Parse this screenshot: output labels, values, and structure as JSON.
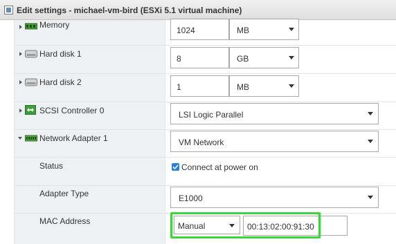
{
  "window": {
    "title": "Edit settings - michael-vm-bird (ESXi 5.1 virtual machine)"
  },
  "rows": {
    "memory": {
      "label": "Memory",
      "value": "1024",
      "unit": "MB"
    },
    "hard_disk_1": {
      "label": "Hard disk 1",
      "value": "8",
      "unit": "GB"
    },
    "hard_disk_2": {
      "label": "Hard disk 2",
      "value": "1",
      "unit": "MB"
    },
    "scsi_controller": {
      "label": "SCSI Controller 0",
      "value": "LSI Logic Parallel"
    },
    "network_adapter": {
      "label": "Network Adapter 1",
      "value": "VM Network"
    },
    "status": {
      "label": "Status",
      "checkbox_label": "Connect at power on",
      "checked": true
    },
    "adapter_type": {
      "label": "Adapter Type",
      "value": "E1000"
    },
    "mac_address": {
      "label": "MAC Address",
      "mode": "Manual",
      "value": "00:13:02:00:91:30"
    }
  },
  "colors": {
    "highlight": "#3fd43f",
    "checkbox": "#2f7ed8",
    "label_cell": "#eef1f4"
  },
  "icons": {
    "title": "vm-settings-icon",
    "memory": "memory-icon",
    "hard_disk": "hard-disk-icon",
    "scsi": "scsi-controller-icon",
    "network": "network-adapter-icon"
  }
}
